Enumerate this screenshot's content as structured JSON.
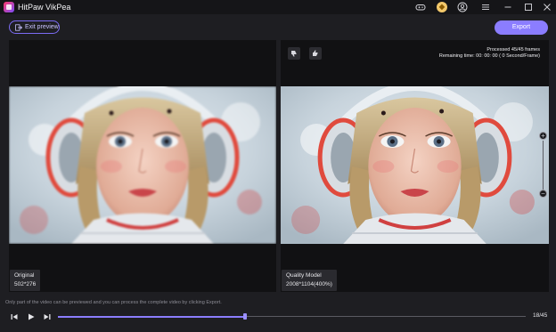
{
  "app": {
    "title": "HitPaw VikPea"
  },
  "toolbar": {
    "exit_label": "Exit preview",
    "export_label": "Export"
  },
  "preview": {
    "processed": "Processed 45/45 frames",
    "remaining": "Remaining time: 00: 00: 00 ( 0 Second/Frame)"
  },
  "original": {
    "label": "Original",
    "resolution": "502*276"
  },
  "enhanced": {
    "label": "Quality Model",
    "resolution": "2008*1104(400%)"
  },
  "notice": "Only part of the video can be previewed and you can process the complete video by clicking Export.",
  "playback": {
    "frame": "18/45",
    "progress": 0.4,
    "total_frames": 45,
    "current_frame": 18
  },
  "colors": {
    "accent": "#8b7dff",
    "panel": "#111113",
    "background": "#1e1e22"
  },
  "icons": [
    "app-logo",
    "gamepad-icon",
    "coin-icon",
    "user-icon",
    "menu-icon",
    "minimize-icon",
    "maximize-icon",
    "close-icon",
    "exit-icon",
    "thumbs-down-icon",
    "thumbs-up-icon",
    "zoom-in-icon",
    "zoom-out-icon",
    "previous-frame-icon",
    "play-icon",
    "next-frame-icon"
  ]
}
